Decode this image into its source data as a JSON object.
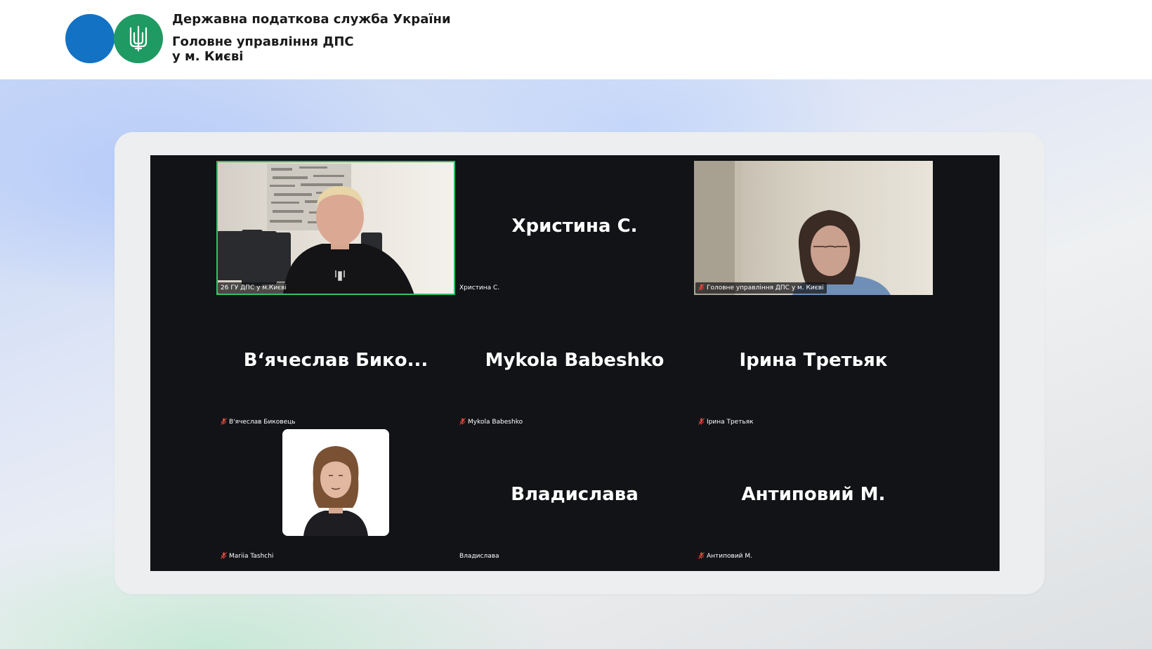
{
  "header": {
    "org_name": "Державна податкова служба України",
    "unit_line1": "Головне управління ДПС",
    "unit_line2": "у м. Києві",
    "brand_colors": {
      "blue": "#1372c4",
      "green": "#1f9a63"
    },
    "emblem_icon": "trident-icon"
  },
  "meeting": {
    "participants": [
      {
        "display": "",
        "tag": "26 ГУ ДПС у м.Києві",
        "video": true,
        "muted": false,
        "active_speaker": true
      },
      {
        "display": "Христина С.",
        "tag": "Христина С.",
        "video": false,
        "muted": false
      },
      {
        "display": "",
        "tag": "Головне управління ДПС у м. Києві",
        "video": true,
        "muted": true
      },
      {
        "display": "В‘ячеслав  Бико...",
        "tag": "В'ячеслав Биковець",
        "video": false,
        "muted": true
      },
      {
        "display": "Mykola Babeshko",
        "tag": "Mykola Babeshko",
        "video": false,
        "muted": true
      },
      {
        "display": "Ірина Третьяк",
        "tag": "Ірина Третьяк",
        "video": false,
        "muted": true
      },
      {
        "display": "",
        "tag": "Mariia Tashchi",
        "video": false,
        "photo": true,
        "muted": true
      },
      {
        "display": "Владислава",
        "tag": "Владислава",
        "video": false,
        "muted": false
      },
      {
        "display": "Антиповий М.",
        "tag": "Антиповий М.",
        "video": false,
        "muted": true
      }
    ],
    "colors": {
      "background": "#111316",
      "active_border": "#2ac46a",
      "muted_icon": "#e0463c"
    }
  }
}
